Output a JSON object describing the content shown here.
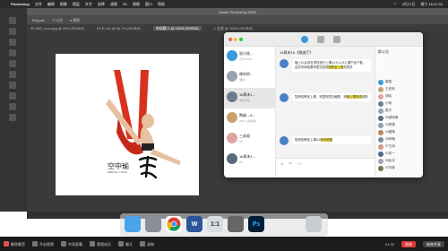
{
  "menubar": {
    "app_name": "Photoshop",
    "items": [
      "文件",
      "编辑",
      "图像",
      "图层",
      "文字",
      "选择",
      "滤镜",
      "3D",
      "视图",
      "窗口",
      "帮助"
    ],
    "clock": "周六 16:47:34",
    "date": "4月27日"
  },
  "photoshop": {
    "title": "Adobe Photoshop 2020",
    "options": [
      "Regular",
      "T 12点",
      "a 锐利"
    ],
    "tabs": [
      "00 IMG_xxxx.jpg @ 25% (RGB/8)",
      "02-Ⅱ-1.tif @ 66.7% (RGB/8)",
      "未标题-1 @ 100% (RGB/8)",
      "x 全部 @ 100% (RGB/8)"
    ],
    "logo_cn": "空中瑜",
    "logo_en": "AERIAL YOGA"
  },
  "chat": {
    "group_title": "16周末1A《跳迪厅》",
    "conversations": [
      {
        "name": "说小秘…",
        "snippet": "上午10:26"
      },
      {
        "name": "夜听的…",
        "snippet": "[图片]"
      },
      {
        "name": "16周末1…",
        "snippet": "未读消息"
      },
      {
        "name": "陶喵→A…",
        "snippet": "Web 上的消息"
      },
      {
        "name": "三叔叔",
        "snippet": "OK"
      },
      {
        "name": "16周末1…",
        "snippet": "OK"
      }
    ],
    "messages": [
      {
        "text_a": "晚上10点将在学校进行上课4.19-4.23上",
        "text_b": "课产品个数，送并有网络要求提交智慧",
        "highlight": "校教室上课",
        "text_c": "完成好"
      },
      {
        "text_a": "智慧校教室上课，完整的提交截图，请",
        "highlight": "晚上课完成",
        "text_c": "填报"
      },
      {
        "text_a": "智慧校教室上课6-8",
        "highlight": "完成填报",
        "text_c": ""
      }
    ],
    "members_header": "群公告",
    "members": [
      "暮雪",
      "王老师",
      "钟晓",
      "小明",
      "数字",
      "06谢晓峰",
      "03顾德",
      "04晨曦",
      "05林楠",
      "07王雨",
      "01张一",
      "08赵月",
      "02刘某"
    ]
  },
  "dock": {
    "apps": [
      "Finder",
      "Launchpad",
      "Chrome",
      "Word",
      "Screen",
      "Prefs",
      "Ps",
      "Trash"
    ],
    "ps_label": "Ps",
    "word_label": "W",
    "screen_label": "1:1"
  },
  "meeting": {
    "buttons": [
      "解除静音",
      "开启视频",
      "共享屏幕",
      "管理成员",
      "聊天",
      "录制"
    ],
    "end_label": "结束",
    "alt_label": "结束共享",
    "timer": "01:32"
  }
}
